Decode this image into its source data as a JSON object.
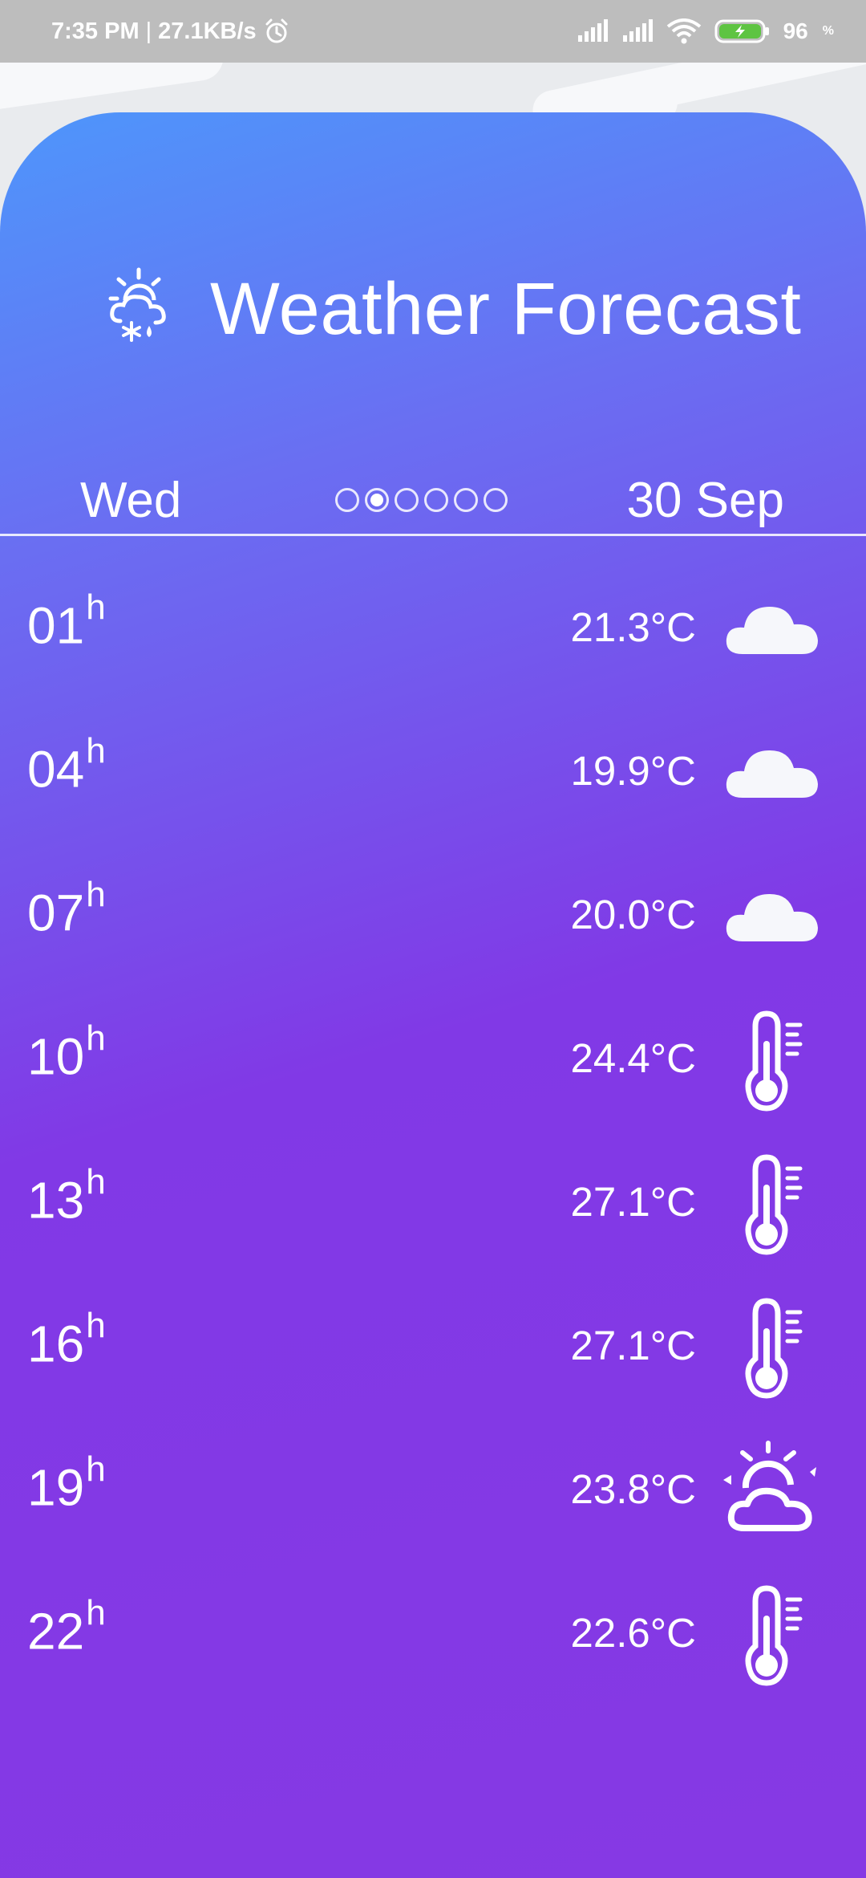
{
  "status_bar": {
    "time": "7:35 PM",
    "separator": "|",
    "speed": "27.1KB/s",
    "battery_level": "96",
    "battery_unit": "%"
  },
  "header": {
    "title": "Weather Forecast",
    "icon": "snow-sun-cloud-icon"
  },
  "day_nav": {
    "day": "Wed",
    "date": "30 Sep",
    "page_count": 6,
    "active_page": 2
  },
  "hourly": [
    {
      "hour": "01",
      "unit": "h",
      "temp": "21.3°C",
      "icon": "cloud-icon"
    },
    {
      "hour": "04",
      "unit": "h",
      "temp": "19.9°C",
      "icon": "cloud-icon"
    },
    {
      "hour": "07",
      "unit": "h",
      "temp": "20.0°C",
      "icon": "cloud-icon"
    },
    {
      "hour": "10",
      "unit": "h",
      "temp": "24.4°C",
      "icon": "thermometer-icon"
    },
    {
      "hour": "13",
      "unit": "h",
      "temp": "27.1°C",
      "icon": "thermometer-icon"
    },
    {
      "hour": "16",
      "unit": "h",
      "temp": "27.1°C",
      "icon": "thermometer-icon"
    },
    {
      "hour": "19",
      "unit": "h",
      "temp": "23.8°C",
      "icon": "sun-cloud-icon"
    },
    {
      "hour": "22",
      "unit": "h",
      "temp": "22.6°C",
      "icon": "thermometer-icon"
    }
  ],
  "colors": {
    "gradient_start": "#4e96fb",
    "gradient_mid": "#6a6ef2",
    "gradient_end": "#8639e4",
    "text": "#ffffff",
    "status_bar": "#bdbdbd"
  }
}
